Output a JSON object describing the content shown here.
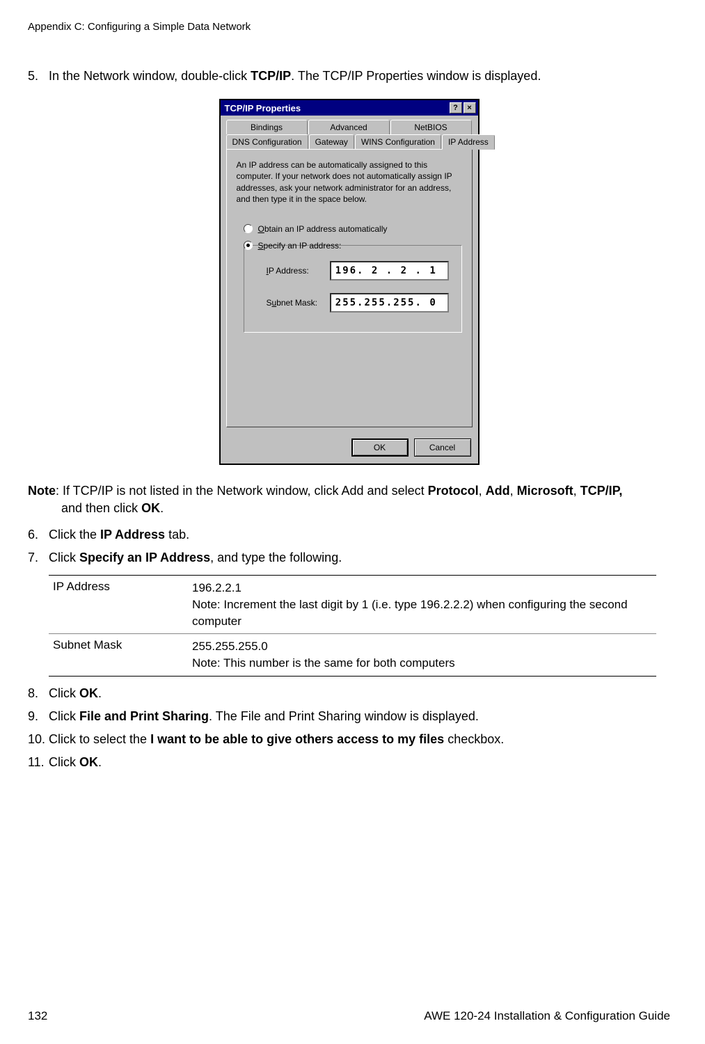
{
  "header": "Appendix C: Configuring a Simple Data Network",
  "steps": {
    "s5": {
      "num": "5.",
      "pre": "In the Network window, double-click ",
      "bold1": "TCP/IP",
      "post": ". The TCP/IP Properties window is displayed."
    },
    "note": {
      "label": "Note",
      "colon": ": If TCP/IP is not listed in the Network window, click Add and select ",
      "b1": "Protocol",
      "c1": ", ",
      "b2": "Add",
      "c2": ", ",
      "b3": "Microsoft",
      "c3": ", ",
      "b4": "TCP/IP,",
      "post": " and then click ",
      "b5": "OK",
      "dot": "."
    },
    "s6": {
      "num": "6.",
      "pre": "Click the ",
      "b": "IP Address",
      "post": " tab."
    },
    "s7": {
      "num": "7.",
      "pre": "Click ",
      "b": "Specify an IP Address",
      "post": ", and type the following."
    },
    "s8": {
      "num": "8.",
      "pre": "Click ",
      "b": "OK",
      "post": "."
    },
    "s9": {
      "num": "9.",
      "pre": "Click ",
      "b": "File and Print Sharing",
      "post": ". The File and Print Sharing window is displayed."
    },
    "s10": {
      "num": "10.",
      "pre": "Click to select the ",
      "b": "I want to be able to give others access to my files",
      "post": " checkbox."
    },
    "s11": {
      "num": "11.",
      "pre": "Click ",
      "b": "OK",
      "post": "."
    }
  },
  "dialog": {
    "title": "TCP/IP Properties",
    "help": "?",
    "close": "×",
    "tabs_row1": [
      "Bindings",
      "Advanced",
      "NetBIOS"
    ],
    "tabs_row2": [
      "DNS Configuration",
      "Gateway",
      "WINS Configuration",
      "IP Address"
    ],
    "info": "An IP address can be automatically assigned to this computer. If your network does not automatically assign IP addresses, ask your network administrator for an address, and then type it in the space below.",
    "radio1_u": "O",
    "radio1_rest": "btain an IP address automatically",
    "radio2_u": "S",
    "radio2_rest": "pecify an IP address:",
    "ip_label_u": "I",
    "ip_label_rest": "P Address:",
    "ip_value": "196. 2 . 2 . 1",
    "mask_label": "S",
    "mask_label_u": "u",
    "mask_label_rest": "bnet Mask:",
    "mask_value": "255.255.255.  0",
    "ok": "OK",
    "cancel": "Cancel"
  },
  "table": {
    "r1": {
      "k": "IP Address",
      "v1": "196.2.2.1",
      "v2": "Note: Increment the last digit by 1 (i.e. type 196.2.2.2) when configuring the second computer"
    },
    "r2": {
      "k": "Subnet Mask",
      "v1": "255.255.255.0",
      "v2": "Note: This number is the same for both computers"
    }
  },
  "footer": {
    "page": "132",
    "title": "AWE 120-24 Installation & Configuration Guide"
  }
}
